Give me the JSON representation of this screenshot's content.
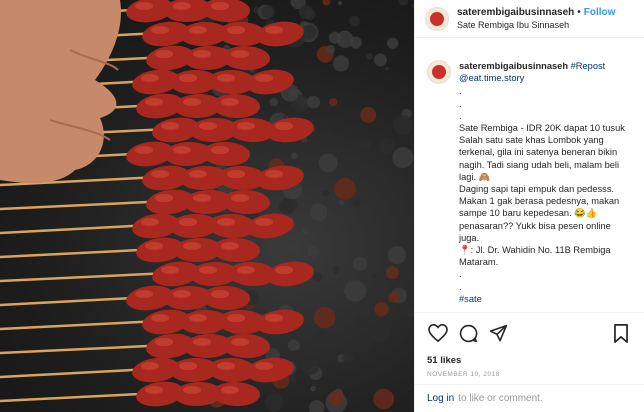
{
  "post": {
    "username": "saterembigaibusinnaseh",
    "follow_label": "Follow",
    "separator": "•",
    "location": "Sate Rembiga Ibu Sinnaseh"
  },
  "caption": {
    "username": "saterembigaibusinnaseh",
    "repost_label": "#Repost",
    "repost_handle": "@eat.time.story",
    "lines": [
      ".",
      ".",
      ".",
      "Sate Rembiga - IDR 20K dapat 10 tusuk",
      "Salah satu sate khas Lombok yang terkenal, gila ini satenya beneran bikin nagih. Tadi siang udah beli, malam beli lagi. 🙈",
      "Daging sapi tapi empuk dan pedesss. Makan 1 gak berasa pedesnya, makan sampe 10 baru kepedesan. 😂👍 penasaran?? Yukk bisa pesen online juga.",
      "📍: Jl. Dr. Wahidin No. 11B Rembiga Mataram.",
      ".",
      ".",
      "#sate"
    ]
  },
  "actions": {
    "like_icon": "heart-icon",
    "comment_icon": "comment-icon",
    "share_icon": "share-icon",
    "save_icon": "bookmark-icon"
  },
  "stats": {
    "likes": "51 likes",
    "date": "NOVEMBER 10, 2018"
  },
  "footer": {
    "login_label": "Log in",
    "suffix": "to like or comment."
  },
  "colors": {
    "link": "#003569",
    "follow": "#3897f0",
    "meat": "#a8281f",
    "skewer": "#d9a35c"
  }
}
